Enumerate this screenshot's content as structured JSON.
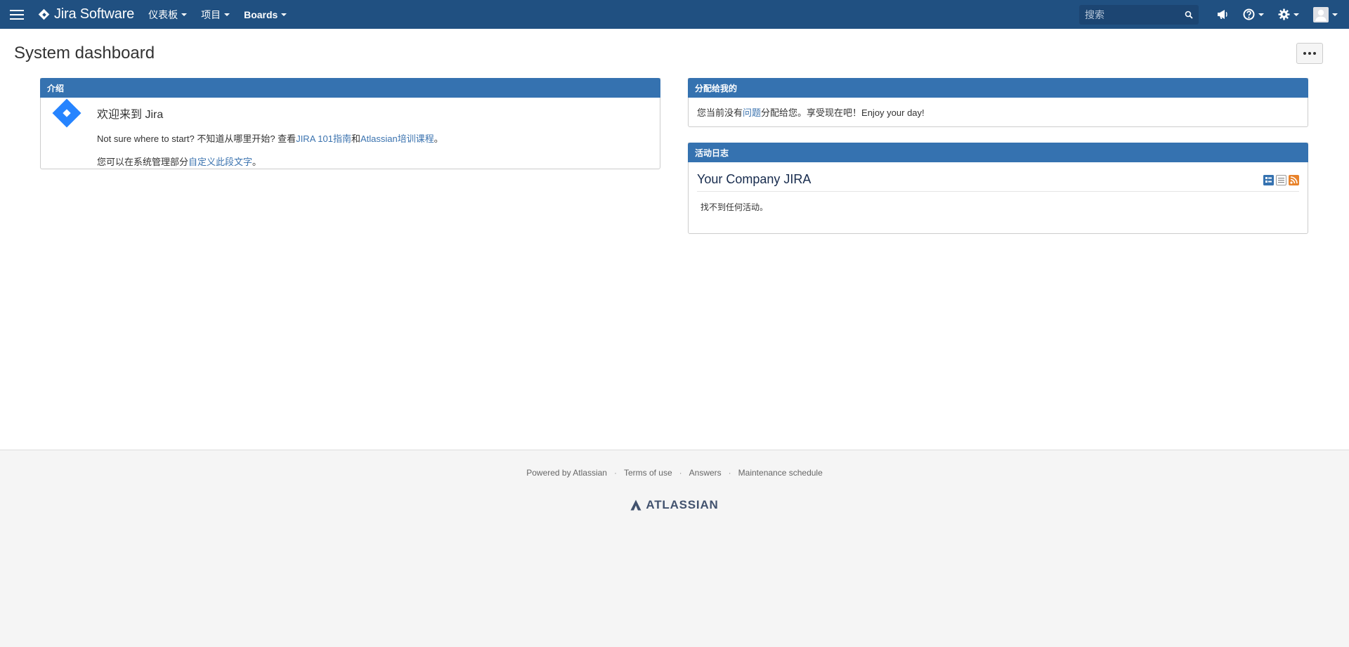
{
  "header": {
    "logo_text": "Jira Software",
    "nav": [
      {
        "label": "仪表板"
      },
      {
        "label": "项目"
      },
      {
        "label": "Boards"
      }
    ],
    "search_placeholder": "搜索",
    "icons": [
      "app-switcher-icon",
      "announcement-icon",
      "help-icon",
      "settings-icon",
      "user-avatar-icon"
    ]
  },
  "page": {
    "title": "System dashboard"
  },
  "gadgets": {
    "intro": {
      "title": "介绍",
      "welcome": "欢迎来到 Jira",
      "line1_pre": "Not sure where to start? 不知道从哪里开始? 查看",
      "line1_link1": "JIRA 101指南",
      "line1_mid": "和",
      "line1_link2": "Atlassian培训课程",
      "line1_post": "。",
      "line2_pre": "您可以在系统管理部分",
      "line2_link": "自定义此段文字",
      "line2_post": "。"
    },
    "assigned": {
      "title": "分配给我的",
      "text_pre": "您当前没有",
      "text_link": "问题",
      "text_post": "分配给您。享受现在吧！Enjoy your day!"
    },
    "activity": {
      "title": "活动日志",
      "stream_title": "Your Company JIRA",
      "empty": "找不到任何活动。"
    }
  },
  "footer": {
    "links": [
      "Powered by Atlassian",
      "Terms of use",
      "Answers",
      "Maintenance schedule"
    ],
    "separator": "·",
    "logo_text": "ATLASSIAN"
  },
  "colors": {
    "header_bg": "#205081",
    "gadget_header": "#3572b0",
    "link": "#3b73af",
    "jira_blue": "#2684ff"
  }
}
